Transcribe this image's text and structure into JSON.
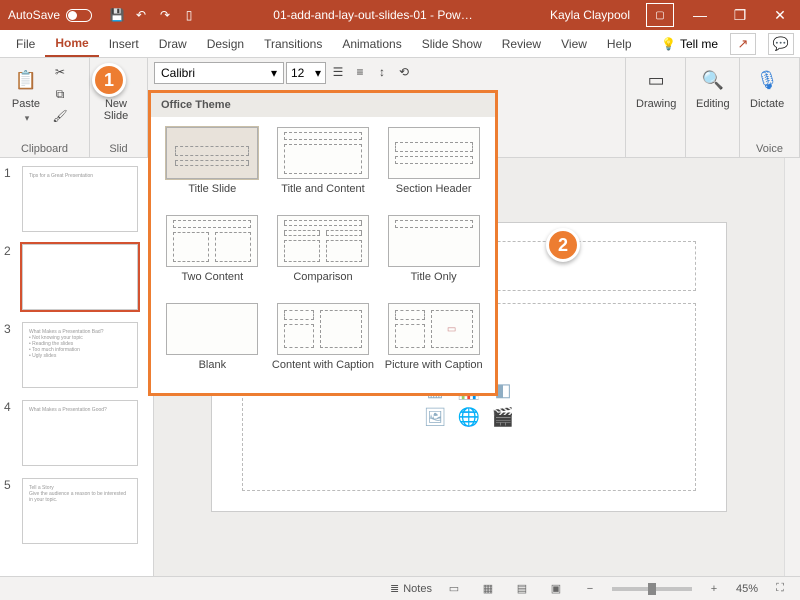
{
  "titlebar": {
    "autosave": "AutoSave",
    "doc_title": "01-add-and-lay-out-slides-01 - Pow…",
    "user": "Kayla Claypool"
  },
  "tabs": {
    "file": "File",
    "home": "Home",
    "insert": "Insert",
    "draw": "Draw",
    "design": "Design",
    "transitions": "Transitions",
    "animations": "Animations",
    "slideshow": "Slide Show",
    "review": "Review",
    "view": "View",
    "help": "Help",
    "tellme": "Tell me"
  },
  "ribbon": {
    "paste": "Paste",
    "clipboard": "Clipboard",
    "newslide": "New\nSlide",
    "slides": "Slid",
    "font_name": "Calibri",
    "font_size": "12",
    "drawing": "Drawing",
    "editing": "Editing",
    "dictate": "Dictate",
    "voice": "Voice"
  },
  "popup": {
    "header": "Office Theme",
    "layouts": [
      "Title Slide",
      "Title and Content",
      "Section Header",
      "Two Content",
      "Comparison",
      "Title Only",
      "Blank",
      "Content with Caption",
      "Picture with Caption"
    ]
  },
  "callouts": {
    "one": "1",
    "two": "2"
  },
  "slides": [
    {
      "n": "1",
      "txt": "Tips for a Great Presentation"
    },
    {
      "n": "2",
      "txt": ""
    },
    {
      "n": "3",
      "txt": "What Makes a Presentation Bad?\n• Not knowing your topic\n• Reading the slides\n• Too much information\n• Ugly slides"
    },
    {
      "n": "4",
      "txt": "What Makes a Presentation Good?"
    },
    {
      "n": "5",
      "txt": "Tell a Story\nGive the audience a reason to be interested in your topic."
    }
  ],
  "status": {
    "notes": "Notes",
    "zoom": "45%",
    "minus": "−",
    "plus": "+"
  }
}
